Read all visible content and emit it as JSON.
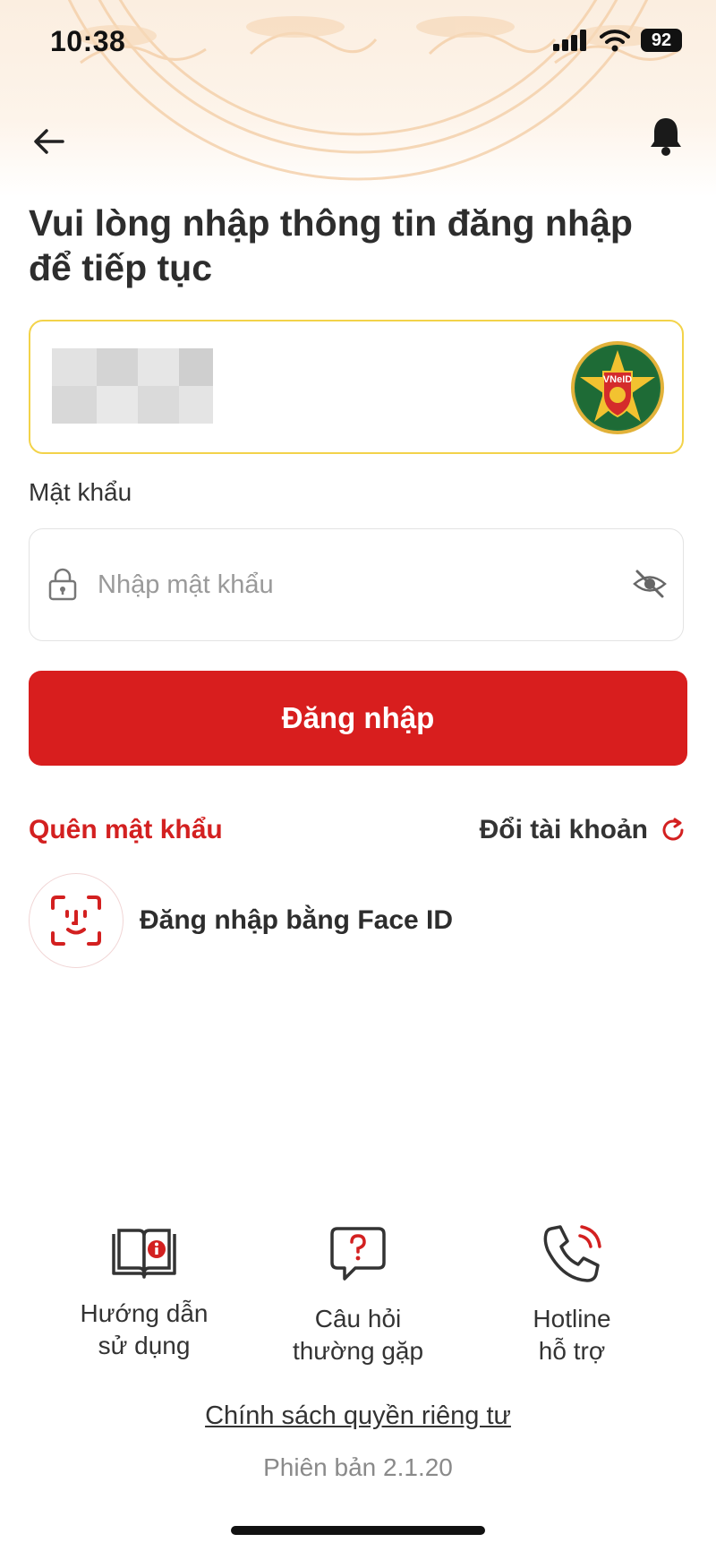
{
  "status_bar": {
    "time": "10:38",
    "battery": "92"
  },
  "header": {
    "back_icon": "arrow-left-icon",
    "notification_icon": "bell-icon"
  },
  "login": {
    "title": "Vui lòng nhập thông tin đăng nhập để tiếp tục",
    "account_badge": "VNeID",
    "password_label": "Mật khẩu",
    "password_placeholder": "Nhập mật khẩu",
    "login_button": "Đăng nhập",
    "forgot_password": "Quên mật khẩu",
    "switch_account": "Đổi tài khoản",
    "face_id": "Đăng nhập bằng Face ID"
  },
  "support": {
    "guide_line1": "Hướng dẫn",
    "guide_line2": "sử dụng",
    "faq_line1": "Câu hỏi",
    "faq_line2": "thường gặp",
    "hotline_line1": "Hotline",
    "hotline_line2": "hỗ trợ"
  },
  "footer": {
    "privacy": "Chính sách quyền riêng tư",
    "version": "Phiên bản 2.1.20"
  },
  "colors": {
    "primary": "#d81e1e",
    "accent_border": "#f3d34a"
  }
}
